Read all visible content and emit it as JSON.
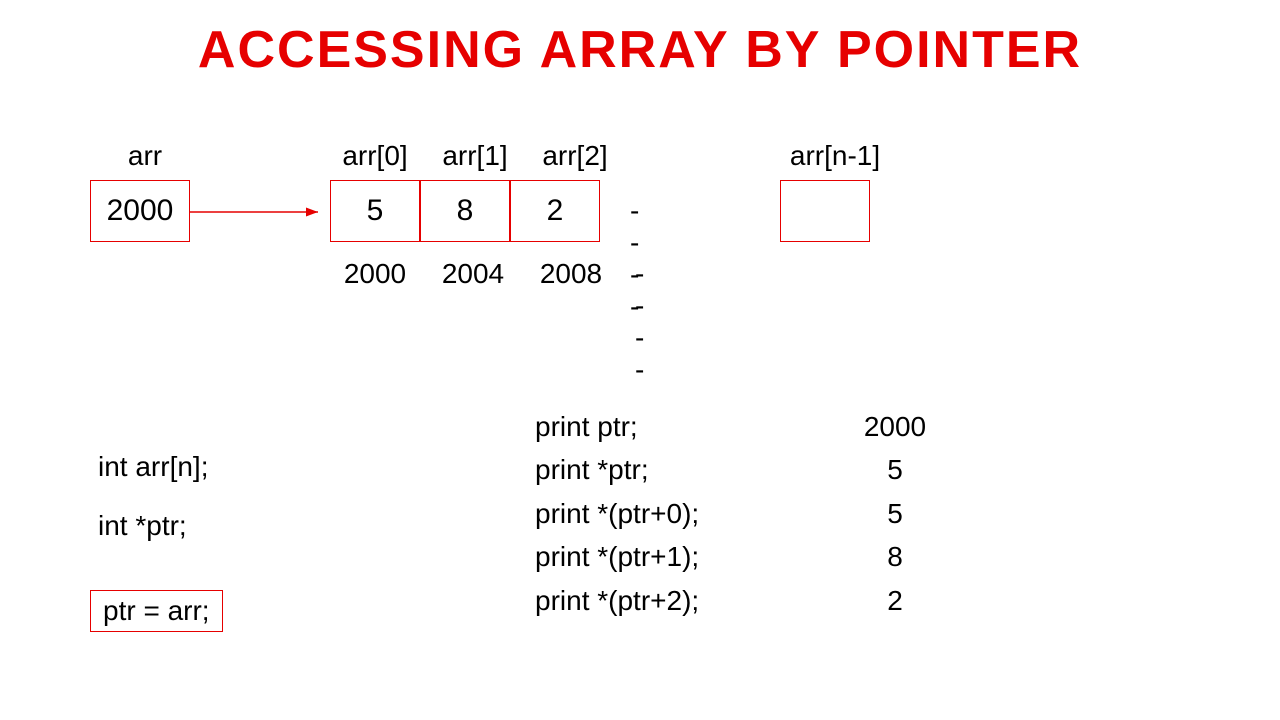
{
  "title": "ACCESSING ARRAY BY POINTER",
  "arr": {
    "var_label": "arr",
    "addr_value": "2000",
    "cells": [
      {
        "index_label": "arr[0]",
        "value": "5",
        "address": "2000"
      },
      {
        "index_label": "arr[1]",
        "value": "8",
        "address": "2004"
      },
      {
        "index_label": "arr[2]",
        "value": "2",
        "address": "2008"
      }
    ],
    "dashes_cells": "- - - -",
    "last_label": "arr[n-1]",
    "dashes_addr": "- - - -"
  },
  "code": {
    "line1": "int arr[n];",
    "line2": "int *ptr;",
    "line3": "ptr = arr;"
  },
  "prints": [
    {
      "stmt": "print ptr;",
      "val": "2000"
    },
    {
      "stmt": "print *ptr;",
      "val": "5"
    },
    {
      "stmt": "print *(ptr+0);",
      "val": "5"
    },
    {
      "stmt": "print *(ptr+1);",
      "val": "8"
    },
    {
      "stmt": "print *(ptr+2);",
      "val": "2"
    }
  ]
}
